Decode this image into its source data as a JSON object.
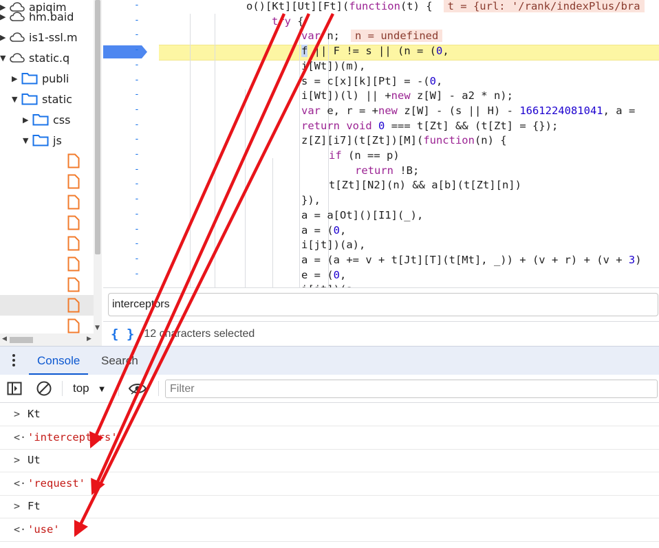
{
  "file_tree": {
    "items": [
      {
        "label": "apiqim",
        "type": "cloud",
        "expanded": false
      },
      {
        "label": "hm.baid",
        "type": "cloud",
        "expanded": false
      },
      {
        "label": "is1-ssl.m",
        "type": "cloud",
        "expanded": false
      },
      {
        "label": "static.q",
        "type": "cloud",
        "expanded": true
      },
      {
        "label": "publi",
        "type": "folder",
        "expanded": false
      },
      {
        "label": "static",
        "type": "folder",
        "expanded": true
      },
      {
        "label": "css",
        "type": "folder",
        "expanded": false
      },
      {
        "label": "js",
        "type": "folder",
        "expanded": true
      },
      {
        "label": "",
        "type": "file"
      },
      {
        "label": "",
        "type": "file"
      },
      {
        "label": "",
        "type": "file"
      },
      {
        "label": "",
        "type": "file"
      },
      {
        "label": "",
        "type": "file"
      },
      {
        "label": "",
        "type": "file"
      },
      {
        "label": "",
        "type": "file"
      },
      {
        "label": "",
        "type": "file"
      },
      {
        "label": "",
        "type": "file"
      }
    ]
  },
  "editor": {
    "gutter_marker": "-",
    "code_lines": [
      "o()[Kt][Ut][Ft](function(t) {",
      "try {",
      "var n;",
      "f || F != s || (n = (0,",
      "i[Wt])(m),",
      "s = c[x][k][Pt] = -(0,",
      "i[Wt])(l) || +new z[W] - a2 * n);",
      "var e, r = +new z[W] - (s || H) - 1661224081041, a =",
      "return void 0 === t[Zt] && (t[Zt] = {});",
      "z[Z][i7](t[Zt])[M](function(n) {",
      "if (n == p)",
      "return !B;",
      "t[Zt][N2](n) && a[b](t[Zt][n])",
      "}),",
      "a = a[Ot]()[I1](_),",
      "a = (0,",
      "i[jt])(a),",
      "a = (a += v + t[Jt][T](t[Mt], _)) + (v + r) + (v + 3)",
      "e = (0,",
      "i[jt])(a,"
    ],
    "inline_values": {
      "t": "t = {url: '/rank/indexPlus/bra",
      "n": "n = undefined"
    }
  },
  "search": {
    "query": "interceptors",
    "status": "12 characters selected",
    "format_icon_glyph": "{ }"
  },
  "drawer": {
    "tabs": [
      {
        "label": "Console",
        "active": true
      },
      {
        "label": "Search",
        "active": false
      }
    ]
  },
  "console_toolbar": {
    "context": "top",
    "filter_placeholder": "Filter"
  },
  "console": {
    "messages": [
      {
        "kind": "input",
        "prefix": ">",
        "text": "Kt"
      },
      {
        "kind": "result",
        "prefix": "<·",
        "text": "'interceptors'"
      },
      {
        "kind": "input",
        "prefix": ">",
        "text": "Ut"
      },
      {
        "kind": "result",
        "prefix": "<·",
        "text": "'request'"
      },
      {
        "kind": "input",
        "prefix": ">",
        "text": "Ft"
      },
      {
        "kind": "result",
        "prefix": "<·",
        "text": "'use'"
      }
    ]
  },
  "colors": {
    "annotation_arrow": "#e8141a",
    "keyword": "#9b2393",
    "number": "#1c00cf",
    "string": "#c41a16",
    "execution_highlight": "#fdf6a3",
    "accent": "#1a73e8"
  }
}
